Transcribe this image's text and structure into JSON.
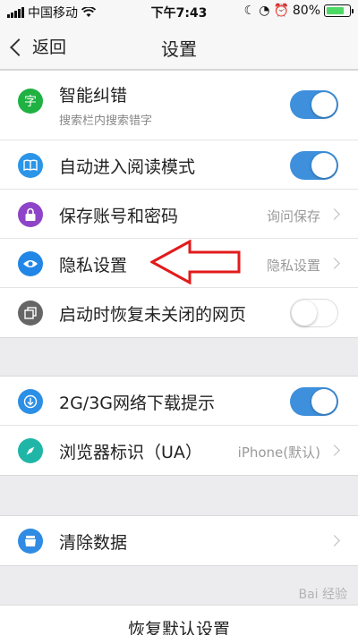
{
  "status_bar": {
    "carrier": "中国移动",
    "time": "下午7:43",
    "battery_text": "80%",
    "battery_level": 0.8
  },
  "nav": {
    "back_label": "返回",
    "title": "设置"
  },
  "group1": [
    {
      "title": "智能纠错",
      "subtitle": "搜索栏内搜索错字",
      "icon": "zi-icon",
      "icon_glyph": "字",
      "icon_color": "#1fb141",
      "control": "toggle",
      "on": true
    },
    {
      "title": "自动进入阅读模式",
      "icon": "book-icon",
      "icon_color": "#2b95e8",
      "control": "toggle",
      "on": true
    },
    {
      "title": "保存账号和密码",
      "value": "询问保存",
      "icon": "lock-icon",
      "icon_color": "#8e44c8",
      "control": "arrow"
    },
    {
      "title": "隐私设置",
      "value": "隐私设置",
      "icon": "eye-icon",
      "icon_color": "#2186e6",
      "control": "arrow"
    },
    {
      "title": "启动时恢复未关闭的网页",
      "icon": "window-icon",
      "icon_color": "#666666",
      "control": "toggle",
      "on": false
    }
  ],
  "group2": [
    {
      "title": "2G/3G网络下载提示",
      "icon": "download-icon",
      "icon_color": "#2b8fe6",
      "control": "toggle",
      "on": true
    },
    {
      "title": "浏览器标识（UA）",
      "value": "iPhone(默认)",
      "icon": "compass-icon",
      "icon_color": "#1fb6a8",
      "control": "arrow"
    }
  ],
  "group3": [
    {
      "title": "清除数据",
      "icon": "broom-icon",
      "icon_color": "#2f8be3",
      "control": "arrow"
    }
  ],
  "footer": {
    "reset_label": "恢复默认设置"
  },
  "watermark": "Bai 经验",
  "colors": {
    "toggle_on": "#3e90dc",
    "annotation_arrow": "#e21b1b"
  }
}
